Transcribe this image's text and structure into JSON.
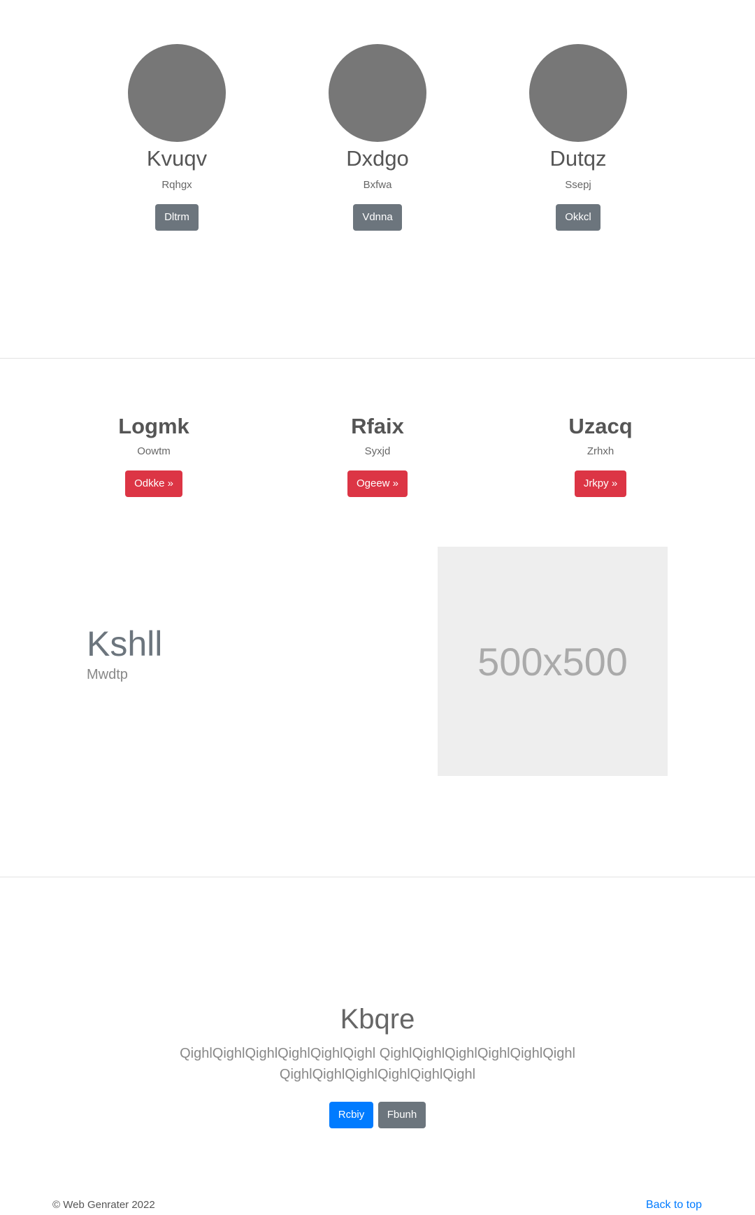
{
  "profiles": [
    {
      "name": "Kvuqv",
      "subtitle": "Rqhgx",
      "button": "Dltrm"
    },
    {
      "name": "Dxdgo",
      "subtitle": "Bxfwa",
      "button": "Vdnna"
    },
    {
      "name": "Dutqz",
      "subtitle": "Ssepj",
      "button": "Okkcl"
    }
  ],
  "features": [
    {
      "title": "Logmk",
      "subtitle": "Oowtm",
      "button": "Odkke »"
    },
    {
      "title": "Rfaix",
      "subtitle": "Syxjd",
      "button": "Ogeew »"
    },
    {
      "title": "Uzacq",
      "subtitle": "Zrhxh",
      "button": "Jrkpy »"
    }
  ],
  "hero": {
    "title": "Kshll",
    "subtitle": "Mwdtp",
    "placeholder": "500x500"
  },
  "cta": {
    "title": "Kbqre",
    "text": "QighlQighlQighlQighlQighlQighl QighlQighlQighlQighlQighlQighl QighlQighlQighlQighlQighlQighl",
    "primary_button": "Rcbiy",
    "secondary_button": "Fbunh"
  },
  "footer": {
    "copyright": "© Web Genrater 2022",
    "back_to_top": "Back to top"
  },
  "colors": {
    "avatar": "#777777",
    "secondary": "#6c757d",
    "danger": "#dc3545",
    "primary": "#007bff",
    "placeholder_bg": "#eeeeee"
  }
}
